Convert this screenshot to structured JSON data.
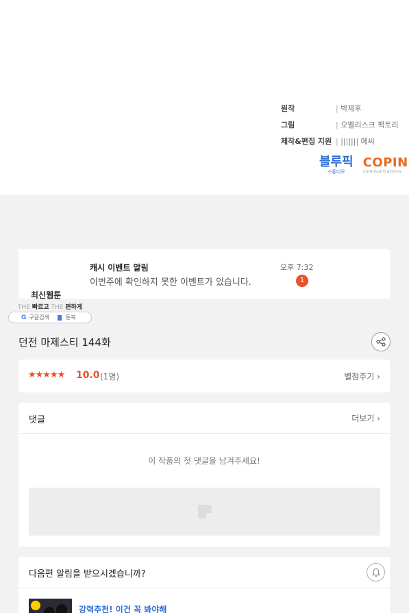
{
  "credits": [
    {
      "role": "원작",
      "name": "박제후"
    },
    {
      "role": "그림",
      "name": "오벨리스크 팩토리"
    },
    {
      "role": "제작&편집 지원",
      "name": "||||||| 에씨"
    }
  ],
  "logos": {
    "bluepick": {
      "main": "블루픽",
      "sub": "스튜디오"
    },
    "copin": {
      "main": "COPIN",
      "sub": "communications"
    }
  },
  "notification": {
    "title": "캐시 이벤트 알림",
    "body": "이번주에 확인하지 못한 이벤트가 있습니다.",
    "time": "오후 7:32",
    "badge": "1"
  },
  "promo": {
    "title": "최신웹툰",
    "tag_the1": "THE",
    "tag_fast": "빠르고",
    "tag_the2": "THE",
    "tag_easy": "편하게",
    "google": "구글검색",
    "toonbook": "툰북"
  },
  "episode": {
    "title": "던전 마제스티 144화"
  },
  "rating": {
    "stars": "★★★★★",
    "score": "10.0",
    "count": "(1명)",
    "rate_link": "별점주기 ›"
  },
  "comments": {
    "title": "댓글",
    "more": "더보기 ›",
    "empty": "이 작품의 첫 댓글을 남겨주세요!"
  },
  "next_alert": {
    "title": "다음편 알림을 받으시겠습니까?"
  },
  "recommend": {
    "title": "강력추천! 이건 꼭 봐야해"
  },
  "colors": {
    "accent": "#e8512a",
    "link_blue": "#2f6fd6"
  }
}
